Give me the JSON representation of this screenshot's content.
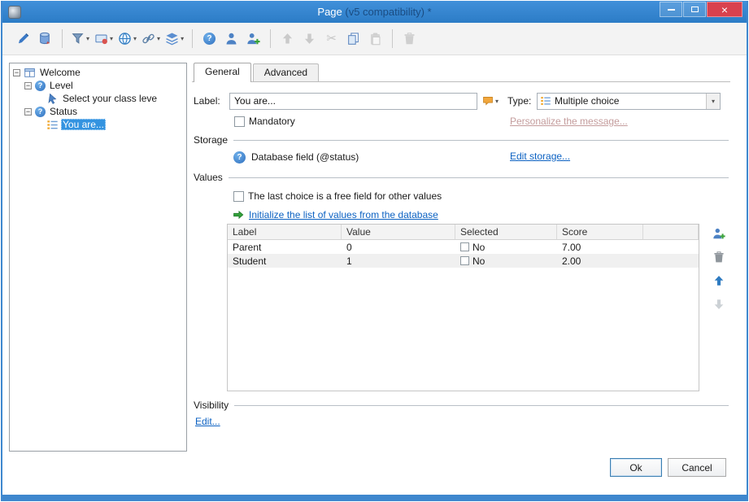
{
  "window": {
    "title": "Page ",
    "title_suffix": "(v5 compatibility) *",
    "controls": {
      "close_glyph": "×"
    }
  },
  "icons": {
    "question_mark": "?",
    "dropdown_arrow": "▾",
    "expander_expanded": "−",
    "scissors": "✂"
  },
  "colors": {
    "titlebar_blue": "#2c7cc6",
    "frame_blue": "#3e87ce",
    "selection_blue": "#3393e0",
    "link_blue": "#0b61c2",
    "disabled_link_pink": "#c49c9c",
    "close_red": "#d9414e"
  },
  "toolbar": {
    "items": [
      "edit-properties",
      "database-export",
      "insert-question",
      "insert-field",
      "web-options",
      "link-options",
      "layers-options",
      "help",
      "contact",
      "add-contact",
      "move-up",
      "move-down",
      "cut",
      "copy",
      "paste",
      "delete"
    ]
  },
  "tree": {
    "items": [
      {
        "label": "Welcome",
        "icon": "page-icon"
      },
      {
        "label": "Level",
        "icon": "question-icon"
      },
      {
        "label": "Select your class leve",
        "icon": "cursor-icon"
      },
      {
        "label": "Status",
        "icon": "question-icon"
      },
      {
        "label": "You are...",
        "icon": "list-icon",
        "selected": true
      }
    ]
  },
  "tabs": {
    "general": "General",
    "advanced": "Advanced"
  },
  "form": {
    "label_caption": "Label:",
    "label_value": "You are...",
    "mandatory_label": "Mandatory",
    "type_caption": "Type:",
    "type_value": "Multiple choice",
    "personalize_link": "Personalize the message..."
  },
  "storage": {
    "title": "Storage",
    "field_text": "Database field (@status)",
    "edit_link": "Edit storage..."
  },
  "values": {
    "title": "Values",
    "free_field_label": "The last choice is a free field for other values",
    "initialize_link": "Initialize the list of values from the database",
    "table": {
      "headers": [
        "Label",
        "Value",
        "Selected",
        "Score"
      ],
      "rows": [
        {
          "label": "Parent",
          "value": "0",
          "selected": "No",
          "score": "7.00"
        },
        {
          "label": "Student",
          "value": "1",
          "selected": "No",
          "score": "2.00"
        }
      ]
    }
  },
  "visibility": {
    "title": "Visibility",
    "edit_link": "Edit..."
  },
  "footer": {
    "ok": "Ok",
    "cancel": "Cancel"
  }
}
